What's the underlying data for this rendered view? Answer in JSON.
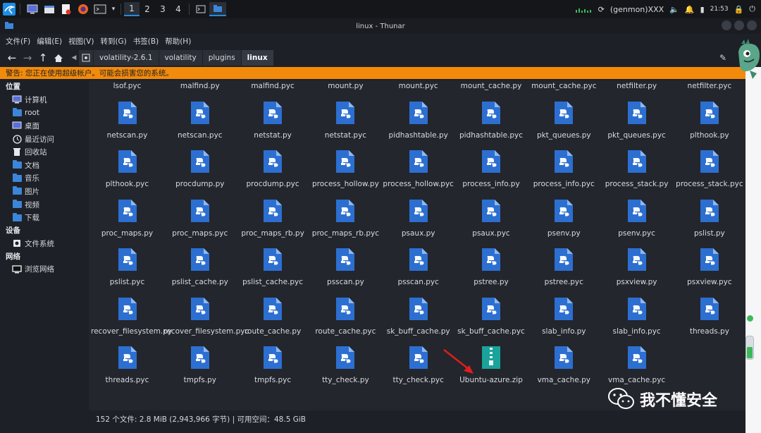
{
  "taskbar": {
    "workspaces": [
      "1",
      "2",
      "3",
      "4"
    ],
    "plugin_label": "(genmon)XXX",
    "clock": "21:53"
  },
  "window": {
    "title": "linux - Thunar"
  },
  "menu": [
    "文件(F)",
    "编辑(E)",
    "视图(V)",
    "转到(G)",
    "书签(B)",
    "帮助(H)"
  ],
  "breadcrumb": [
    "volatility-2.6.1",
    "volatility",
    "plugins",
    "linux"
  ],
  "warning": "警告: 您正在使用超级帐户。可能会损害您的系统。",
  "sidebar": {
    "places_title": "位置",
    "places": [
      {
        "label": "计算机",
        "icon": "computer-icon"
      },
      {
        "label": "root",
        "icon": "home-folder-icon"
      },
      {
        "label": "桌面",
        "icon": "desktop-icon"
      },
      {
        "label": "最近访问",
        "icon": "recent-icon"
      },
      {
        "label": "回收站",
        "icon": "trash-icon"
      },
      {
        "label": "文档",
        "icon": "folder-icon"
      },
      {
        "label": "音乐",
        "icon": "folder-icon"
      },
      {
        "label": "图片",
        "icon": "folder-icon"
      },
      {
        "label": "视频",
        "icon": "folder-icon"
      },
      {
        "label": "下载",
        "icon": "download-folder-icon"
      }
    ],
    "devices_title": "设备",
    "devices": [
      {
        "label": "文件系统",
        "icon": "drive-icon"
      }
    ],
    "network_title": "网络",
    "network": [
      {
        "label": "浏览网络",
        "icon": "network-icon"
      }
    ]
  },
  "files": [
    "lsof.pyc",
    "malfind.py",
    "malfind.pyc",
    "mount.py",
    "mount.pyc",
    "mount_cache.py",
    "mount_cache.pyc",
    "netfilter.py",
    "netfilter.pyc",
    "netscan.py",
    "netscan.pyc",
    "netstat.py",
    "netstat.pyc",
    "pidhashtable.py",
    "pidhashtable.pyc",
    "pkt_queues.py",
    "pkt_queues.pyc",
    "plthook.py",
    "plthook.pyc",
    "procdump.py",
    "procdump.pyc",
    "process_hollow.py",
    "process_hollow.pyc",
    "process_info.py",
    "process_info.pyc",
    "process_stack.py",
    "process_stack.pyc",
    "proc_maps.py",
    "proc_maps.pyc",
    "proc_maps_rb.py",
    "proc_maps_rb.pyc",
    "psaux.py",
    "psaux.pyc",
    "psenv.py",
    "psenv.pyc",
    "pslist.py",
    "pslist.pyc",
    "pslist_cache.py",
    "pslist_cache.pyc",
    "psscan.py",
    "psscan.pyc",
    "pstree.py",
    "pstree.pyc",
    "psxview.py",
    "psxview.pyc",
    "recover_filesystem.py",
    "recover_filesystem.pyc",
    "route_cache.py",
    "route_cache.pyc",
    "sk_buff_cache.py",
    "sk_buff_cache.pyc",
    "slab_info.py",
    "slab_info.pyc",
    "threads.py",
    "threads.pyc",
    "tmpfs.py",
    "tmpfs.pyc",
    "tty_check.py",
    "tty_check.pyc",
    "Ubuntu-azure.zip",
    "vma_cache.py",
    "vma_cache.pyc"
  ],
  "status": "152 个文件: 2.8 MiB (2,943,966 字节)  |  可用空间：48.5 GiB",
  "watermark": "我不懂安全"
}
